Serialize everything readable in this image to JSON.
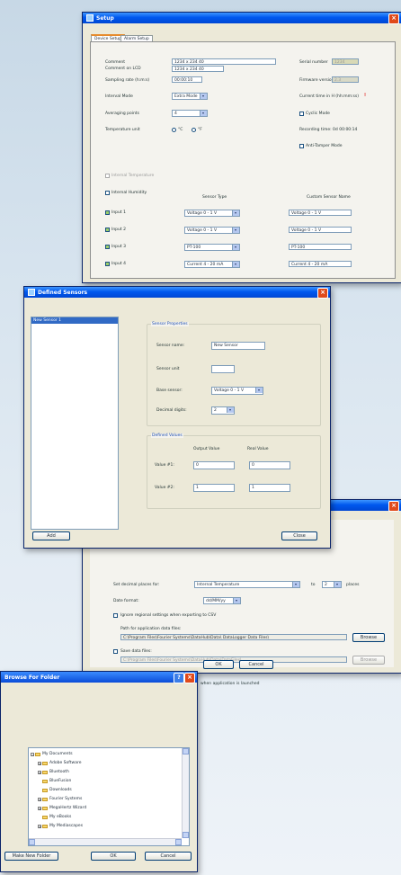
{
  "setup": {
    "title": "Setup",
    "tabs": [
      "Device Setup",
      "Alarm Setup"
    ],
    "rows": {
      "comment_label": "Comment",
      "comment_value": "1234 x 234 40",
      "comment_lcd_label": "Comment on LCD",
      "comment_lcd_value": "1234 x 234 40",
      "sampling_label": "Sampling rate (h:m:s)",
      "sampling_value": "00:00:10",
      "interval_label": "Interval Mode",
      "interval_value": "Extra Mode",
      "averaging_label": "Averaging points",
      "averaging_value": "4",
      "temp_unit_label": "Temperature unit",
      "unit_c": "°C",
      "unit_f": "°F"
    },
    "right": {
      "serial_label": "Serial number",
      "serial_value": "1234",
      "firmware_label": "Firmware version",
      "firmware_value": "2.3",
      "remaining_label": "Current time in H (hh:mm:ss)",
      "remaining_value": "!",
      "cyclic_label": "Cyclic Mode",
      "recording_label": "Recording time: 0d 00:00:14",
      "tamper_label": "Anti-Tamper Mode"
    },
    "internal_temp_label": "Internal Temperature",
    "internal_humidity_label": "Internal Humidity",
    "col_sensor_type": "Sensor Type",
    "col_custom_name": "Custom Sensor Name",
    "inputs": [
      {
        "label": "Input 1",
        "type": "Voltage 0 - 1 V",
        "name": "Voltage 0 - 1 V"
      },
      {
        "label": "Input 2",
        "type": "Voltage 0 - 1 V",
        "name": "Voltage 0 - 1 V"
      },
      {
        "label": "Input 3",
        "type": "PT-100",
        "name": "PT-100"
      },
      {
        "label": "Input 4",
        "type": "Current 4 - 20 mA",
        "name": "Current 4 - 20 mA"
      }
    ]
  },
  "defined": {
    "title": "Defined Sensors",
    "list_item": "New Sensor 1",
    "props_title": "Sensor Properties",
    "name_label": "Sensor name:",
    "name_value": "New Sensor",
    "unit_label": "Sensor unit",
    "unit_value": "",
    "base_label": "Base sensor:",
    "base_value": "Voltage 0 - 1 V",
    "digits_label": "Decimal digits:",
    "digits_value": "2",
    "defined_title": "Defined Values",
    "output_header": "Output Value",
    "real_header": "Real Value",
    "v1_label": "Value #1:",
    "v1_out": "0",
    "v1_real": "0",
    "v2_label": "Value #2:",
    "v2_out": "1",
    "v2_real": "1",
    "add_button": "Add",
    "close_button": "Close"
  },
  "options": {
    "decimal_label": "Set decimal places for:",
    "decimal_sensor": "Internal Temperature",
    "to_label": "to",
    "decimal_value": "2",
    "places_label": "places",
    "date_format_label": "Date format:",
    "date_format_value": "dd/MM/yy",
    "ignore_label": "Ignore regional settings when exporting to CSV",
    "path_label": "Path for application data files:",
    "path_value": "C:\\Program Files\\Fourier Systems\\DataHub\\Data\\ DataLogger Data Files\\",
    "browse_label": "Browse",
    "save_label": "Save data files:",
    "save_path": "C:\\Program Files\\Fourier Systems\\DataHub\\Data\\DataFiles\\",
    "browse2_label": "Browse",
    "launch_label": "when application is launched",
    "ok_label": "OK",
    "cancel_label": "Cancel"
  },
  "browse": {
    "title": "Browse For Folder",
    "items": [
      {
        "label": "My Documents",
        "indent": 0,
        "plus": true
      },
      {
        "label": "Adobe Software",
        "indent": 1,
        "plus": true
      },
      {
        "label": "Bluetooth",
        "indent": 1,
        "plus": true
      },
      {
        "label": "BlueFusion",
        "indent": 1,
        "plus": false
      },
      {
        "label": "Downloads",
        "indent": 1,
        "plus": false
      },
      {
        "label": "Fourier Systems",
        "indent": 1,
        "plus": true
      },
      {
        "label": "MegaHertz Wizard",
        "indent": 1,
        "plus": true
      },
      {
        "label": "My eBooks",
        "indent": 1,
        "plus": false
      },
      {
        "label": "My Mediascapes",
        "indent": 1,
        "plus": true
      }
    ],
    "new_folder": "Make New Folder",
    "ok": "OK",
    "cancel": "Cancel"
  }
}
